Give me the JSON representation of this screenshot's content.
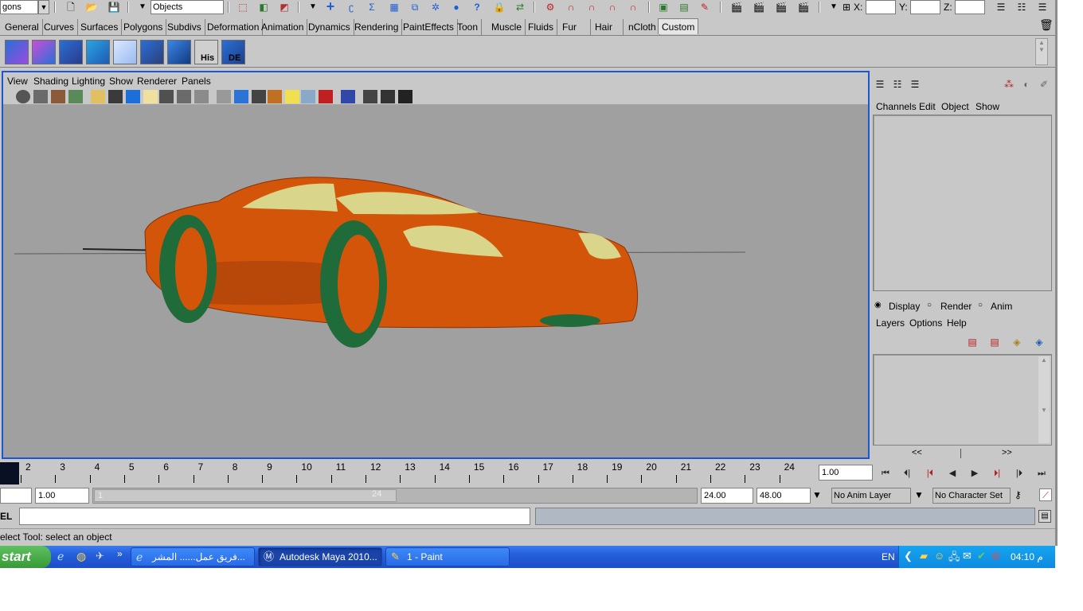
{
  "status_line": {
    "mode_combo": "gons",
    "selection_mask_combo": "Objects",
    "xyz_labels": {
      "x": "X:",
      "y": "Y:",
      "z": "Z:"
    },
    "xyz_values": {
      "x": "",
      "y": "",
      "z": ""
    }
  },
  "shelf": {
    "tabs": [
      "General",
      "Curves",
      "Surfaces",
      "Polygons",
      "Subdivs",
      "Deformation",
      "Animation",
      "Dynamics",
      "Rendering",
      "PaintEffects",
      "Toon",
      "Muscle",
      "Fluids",
      "Fur",
      "Hair",
      "nCloth",
      "Custom"
    ],
    "active_tab": "Custom",
    "icon_labels": {
      "his": "His",
      "de": "DE"
    }
  },
  "viewport": {
    "menu": [
      "View",
      "Shading",
      "Lighting",
      "Show",
      "Renderer",
      "Panels"
    ],
    "background_color": "#a0a0a0",
    "body_color": "#d2550a",
    "glass_color": "#d9d58a",
    "tire_color": "#1f6b3a"
  },
  "channel_box": {
    "menu": [
      "Channels",
      "Edit",
      "Object",
      "Show"
    ]
  },
  "layer_editor": {
    "radio_options": [
      "Display",
      "Render",
      "Anim"
    ],
    "selected_option": "Display",
    "menu": [
      "Layers",
      "Options",
      "Help"
    ],
    "scroll_left": "<<",
    "scroll_right": ">>"
  },
  "time_slider": {
    "ticks": [
      "2",
      "3",
      "4",
      "5",
      "6",
      "7",
      "8",
      "9",
      "10",
      "11",
      "12",
      "13",
      "14",
      "15",
      "16",
      "17",
      "18",
      "19",
      "20",
      "21",
      "22",
      "23",
      "24"
    ],
    "current_frame": "1.00"
  },
  "range_slider": {
    "start_time": "1.00",
    "range_start_label": "1",
    "range_end_label": "24",
    "playback_end": "24.00",
    "animation_end": "48.00",
    "anim_layer": "No Anim Layer",
    "character_set": "No Character Set"
  },
  "command_line": {
    "label": "EL",
    "input_value": ""
  },
  "help_line": {
    "text": "elect Tool: select an object"
  },
  "taskbar": {
    "start_label": "start",
    "overflow_label": "»",
    "buttons": [
      {
        "label": "فريق عمل...... المشر...",
        "active": false
      },
      {
        "label": "Autodesk Maya 2010...",
        "active": true
      },
      {
        "label": "1 - Paint",
        "active": false
      }
    ],
    "language": "EN",
    "clock": "04:10 م"
  }
}
